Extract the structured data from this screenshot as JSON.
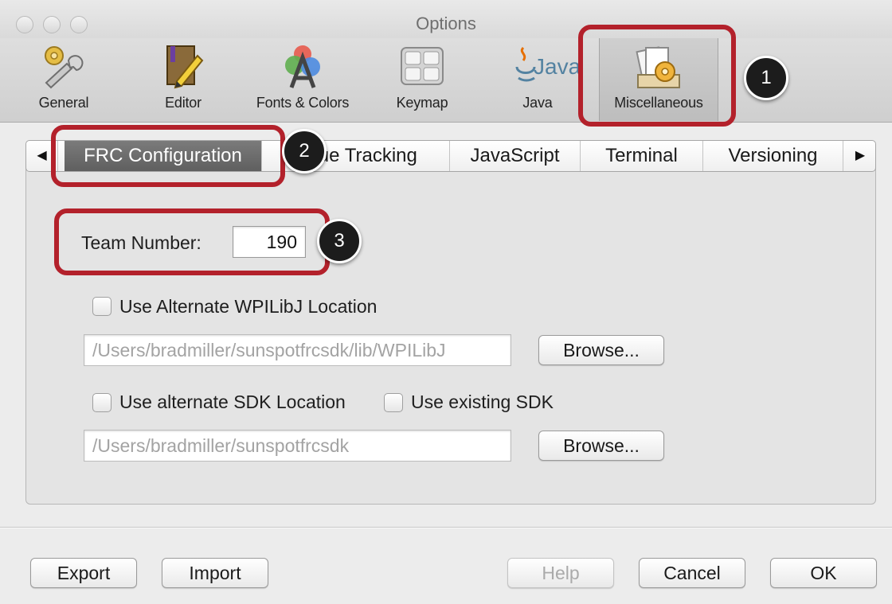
{
  "window": {
    "title": "Options"
  },
  "toolbar": {
    "items": [
      {
        "label": "General",
        "icon": "wrench-gear-icon"
      },
      {
        "label": "Editor",
        "icon": "pencil-notebook-icon"
      },
      {
        "label": "Fonts & Colors",
        "icon": "font-palette-icon"
      },
      {
        "label": "Keymap",
        "icon": "keyboard-icon"
      },
      {
        "label": "Java",
        "icon": "java-logo-icon"
      },
      {
        "label": "Miscellaneous",
        "icon": "misc-gear-papers-icon"
      }
    ],
    "java_logo_text": "Java"
  },
  "tabs": {
    "items": [
      {
        "label": "FRC Configuration"
      },
      {
        "label": "Issue Tracking"
      },
      {
        "label": "JavaScript"
      },
      {
        "label": "Terminal"
      },
      {
        "label": "Versioning"
      }
    ],
    "left_arrow": "◀",
    "right_arrow": "▶"
  },
  "form": {
    "team_number_label": "Team Number:",
    "team_number_value": "190",
    "alt_wpilibj_label": "Use Alternate WPILibJ Location",
    "wpilibj_path": "/Users/bradmiller/sunspotfrcsdk/lib/WPILibJ",
    "alt_sdk_label": "Use alternate SDK Location",
    "existing_sdk_label": "Use existing SDK",
    "sdk_path": "/Users/bradmiller/sunspotfrcsdk",
    "browse_label": "Browse..."
  },
  "footer": {
    "export_label": "Export",
    "import_label": "Import",
    "help_label": "Help",
    "cancel_label": "Cancel",
    "ok_label": "OK"
  },
  "annotations": {
    "badge1": "1",
    "badge2": "2",
    "badge3": "3"
  },
  "colors": {
    "callout_red": "#b3212b",
    "selected_tab": "#6b6b6b"
  }
}
